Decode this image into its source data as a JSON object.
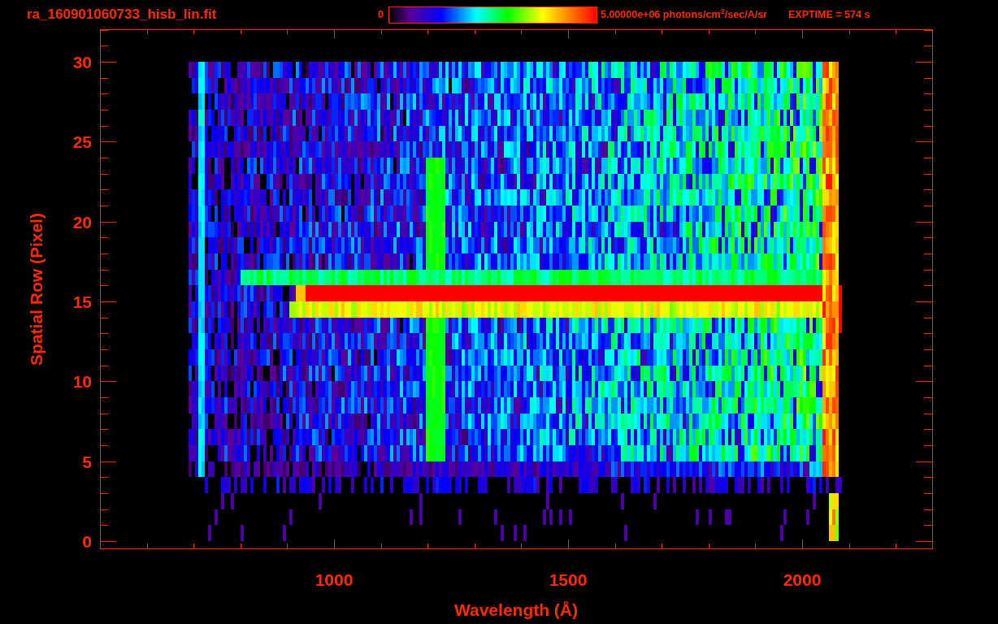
{
  "header": {
    "filename": "ra_160901060733_hisb_lin.fit",
    "colorbar": {
      "min_label": "0",
      "max_label": "5.00000e+06 photons/cm$^{2}$/sec/A/sr"
    },
    "exposure": "EXPTIME = 574 s"
  },
  "plot": {
    "xlabel": "Wavelength (Å)",
    "ylabel": "Spatial Row (Pixel)",
    "xticks": [
      "1000",
      "1500",
      "2000"
    ],
    "yticks": [
      "30",
      "25",
      "20",
      "15",
      "10",
      "5",
      "0"
    ]
  }
}
